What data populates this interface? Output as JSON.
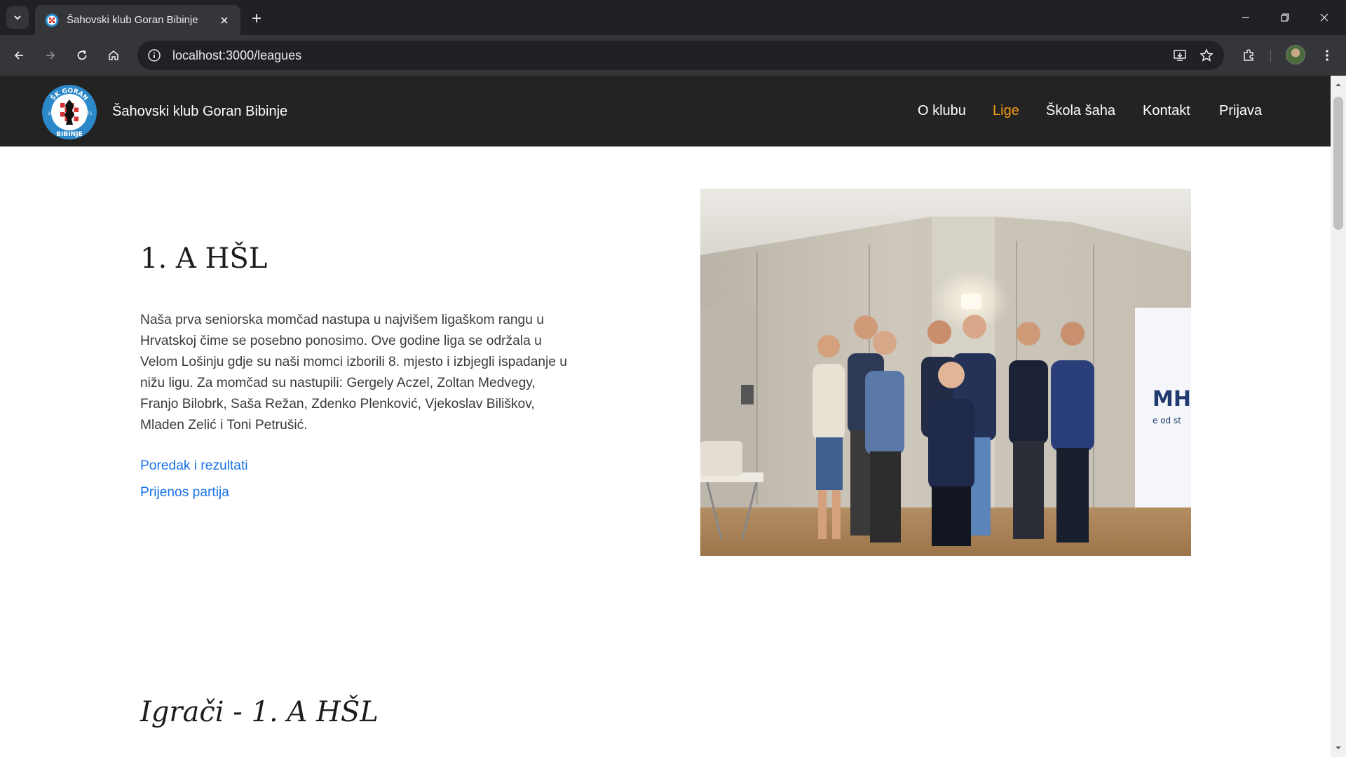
{
  "browser": {
    "tab_title": "Šahovski klub Goran Bibinje",
    "url": "localhost:3000/leagues"
  },
  "site": {
    "brand": "Šahovski klub Goran Bibinje",
    "logo_text_top": "ŠK GORAN",
    "logo_text_bottom": "BIBINJE",
    "logo_year_left": "19",
    "logo_year_right": "71",
    "nav": [
      {
        "label": "O klubu",
        "active": false
      },
      {
        "label": "Lige",
        "active": true
      },
      {
        "label": "Škola šaha",
        "active": false
      },
      {
        "label": "Kontakt",
        "active": false
      },
      {
        "label": "Prijava",
        "active": false
      }
    ],
    "accent_color": "#f39c12"
  },
  "league": {
    "title": "1. A HŠL",
    "description": "Naša prva seniorska momčad nastupa u najvišem ligaškom rangu u Hrvatskoj čime se posebno ponosimo. Ove godine liga se održala u Velom Lošinju gdje su naši momci izborili 8. mjesto i izbjegli ispadanje u nižu ligu. Za momčad su nastupili: Gergely Aczel, Zoltan Medvegy, Franjo Bilobrk, Saša Režan, Zdenko Plenković, Vjekoslav Biliškov, Mladen Zelić i Toni Petrušić.",
    "links": [
      "Poredak i rezultati",
      "Prijenos partija"
    ],
    "photo_banner_text": "MHI",
    "photo_banner_sub": "e od st"
  },
  "players": {
    "title": "Igrači - 1. A HŠL"
  }
}
